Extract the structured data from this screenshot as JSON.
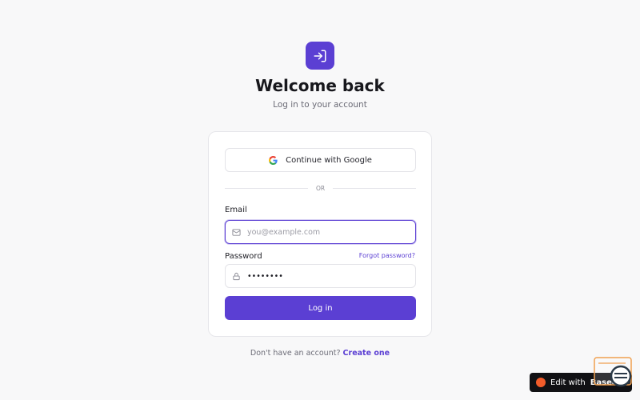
{
  "header": {
    "title": "Welcome back",
    "subtitle": "Log in to your account"
  },
  "auth": {
    "google_label": "Continue with Google",
    "divider_label": "OR"
  },
  "form": {
    "email_label": "Email",
    "email_placeholder": "you@example.com",
    "password_label": "Password",
    "password_value": "••••••••",
    "forgot_label": "Forgot password?",
    "submit_label": "Log in"
  },
  "footer": {
    "prompt": "Don't have an account?",
    "create_label": "Create one"
  },
  "badge": {
    "prefix": "Edit with",
    "brand": "Base44"
  },
  "colors": {
    "accent": "#5b3fd3",
    "background": "#f8f8f9",
    "badge": "#111114"
  },
  "icons": {
    "logo": "login-arrow-icon",
    "google": "google-icon",
    "email": "mail-icon",
    "password": "lock-icon"
  }
}
